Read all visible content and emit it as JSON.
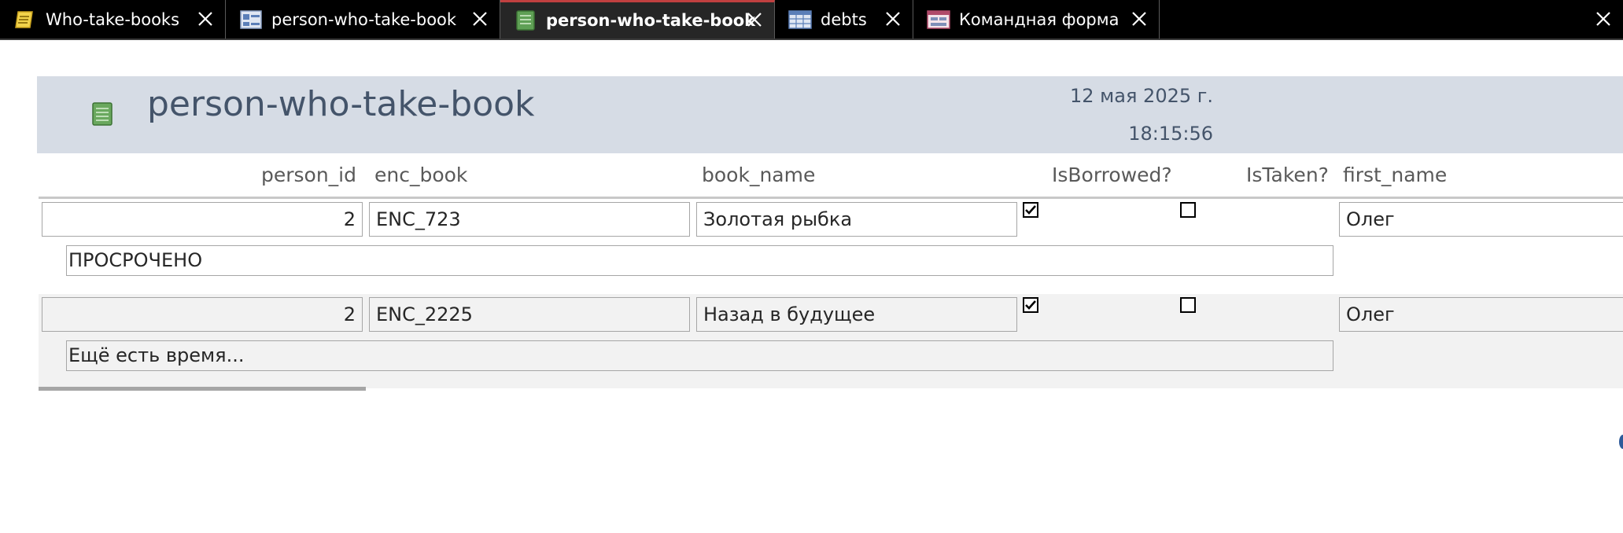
{
  "tabs": [
    {
      "label": "Who-take-books",
      "icon": "report-icon"
    },
    {
      "label": "person-who-take-book",
      "icon": "form-icon"
    },
    {
      "label": "person-who-take-book",
      "icon": "report-green-icon",
      "active": true
    },
    {
      "label": "debts",
      "icon": "table-icon"
    },
    {
      "label": "Командная форма",
      "icon": "form-window-icon"
    }
  ],
  "report": {
    "title": "person-who-take-book",
    "date": "12 мая 2025 г.",
    "time": "18:15:56"
  },
  "columns": {
    "person_id": "person_id",
    "enc_book": "enc_book",
    "book_name": "book_name",
    "is_borrowed": "IsBorrowed?",
    "is_taken": "IsTaken?",
    "first_name": "first_name"
  },
  "rows": [
    {
      "person_id": "2",
      "enc_book": "ENC_723",
      "book_name": "Золотая рыбка",
      "is_borrowed": true,
      "is_taken": false,
      "first_name": "Олег",
      "status": "ПРОСРОЧЕНО"
    },
    {
      "person_id": "2",
      "enc_book": "ENC_2225",
      "book_name": "Назад в будущее",
      "is_borrowed": true,
      "is_taken": false,
      "first_name": "Олег",
      "status": "Ещё есть время..."
    }
  ],
  "colors": {
    "tabbar_bg": "#000000",
    "header_bg": "#d6dce5",
    "title_color": "#44546a",
    "alt_row_bg": "#f2f2f2"
  }
}
